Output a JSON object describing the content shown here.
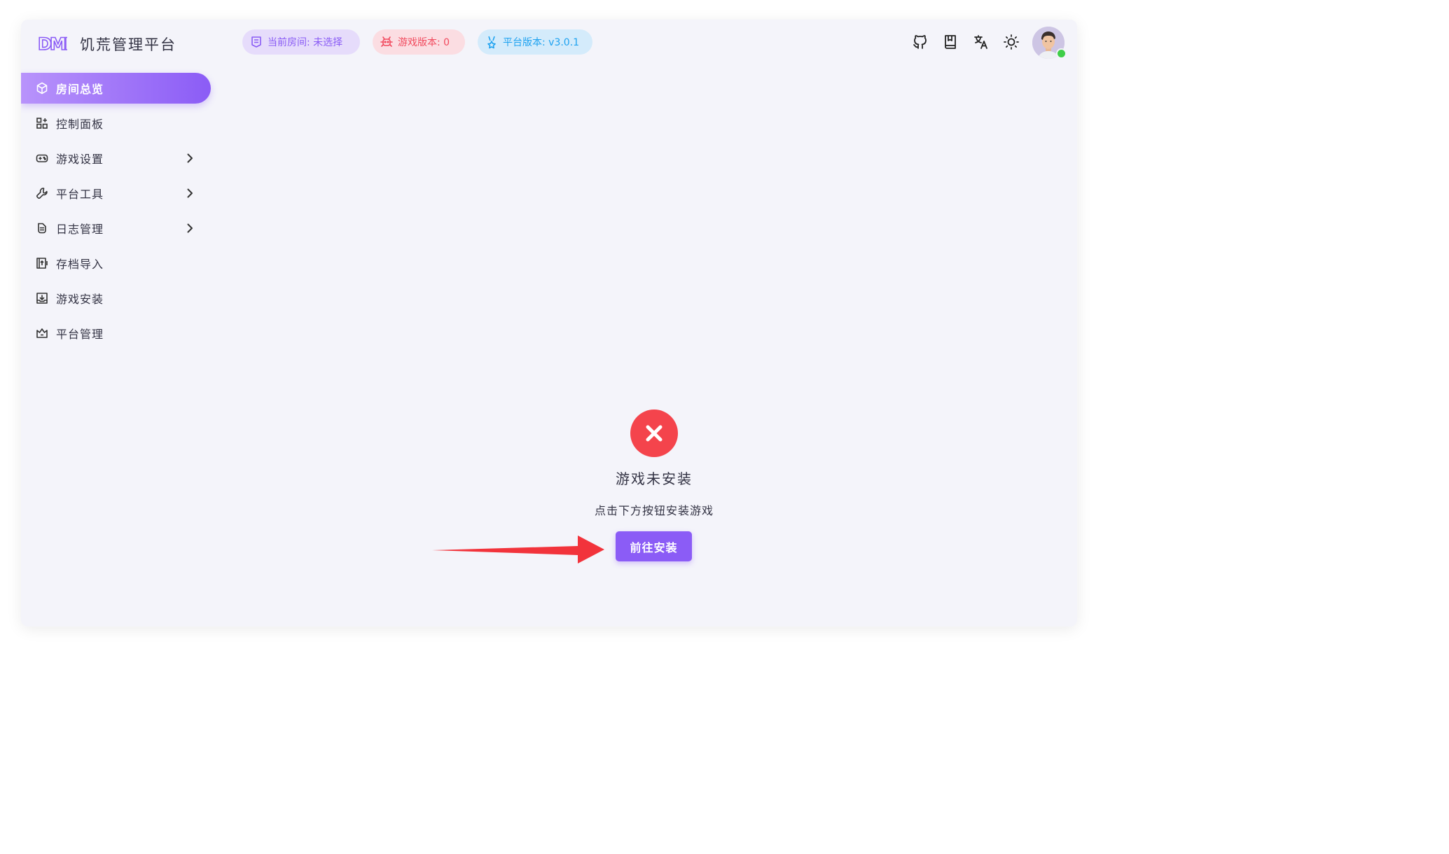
{
  "app": {
    "title": "饥荒管理平台",
    "logo_text": "DMP",
    "brand_color": "#8b5cf6"
  },
  "header": {
    "chips": {
      "room": {
        "label": "当前房间: 未选择",
        "color": "#8a5cf5"
      },
      "game_version": {
        "label": "游戏版本: 0",
        "color": "#f14a5e"
      },
      "platform_version": {
        "label": "平台版本: v3.0.1",
        "color": "#1ea2f0"
      }
    },
    "icons": [
      "github-icon",
      "book-icon",
      "translate-icon",
      "sun-icon"
    ]
  },
  "sidebar": {
    "items": [
      {
        "label": "房间总览",
        "icon": "cube-icon",
        "active": true,
        "expandable": false
      },
      {
        "label": "控制面板",
        "icon": "dashboard-icon",
        "active": false,
        "expandable": false
      },
      {
        "label": "游戏设置",
        "icon": "gamepad-icon",
        "active": false,
        "expandable": true
      },
      {
        "label": "平台工具",
        "icon": "wrench-icon",
        "active": false,
        "expandable": true
      },
      {
        "label": "日志管理",
        "icon": "log-icon",
        "active": false,
        "expandable": true
      },
      {
        "label": "存档导入",
        "icon": "import-icon",
        "active": false,
        "expandable": false
      },
      {
        "label": "游戏安装",
        "icon": "install-icon",
        "active": false,
        "expandable": false
      },
      {
        "label": "平台管理",
        "icon": "crown-icon",
        "active": false,
        "expandable": false
      }
    ]
  },
  "main": {
    "status_title": "游戏未安装",
    "status_subtitle": "点击下方按钮安装游戏",
    "install_button": "前往安装",
    "error_color": "#f4444c",
    "annotation_color": "#f2333b"
  }
}
